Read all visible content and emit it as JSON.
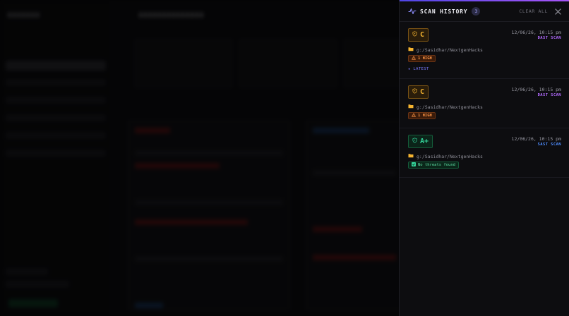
{
  "drawer": {
    "title": "SCAN HISTORY",
    "count": "3",
    "clear_label": "CLEAR ALL",
    "icon": "activity-icon",
    "close_icon": "close-icon",
    "accent_colors": [
      "#4f46e5",
      "#a855f7"
    ]
  },
  "entries": [
    {
      "grade": "C",
      "grade_icon": "shield-icon",
      "timestamp": "12/06/26, 10:15 pm",
      "scan_type": "DAST SCAN",
      "scan_type_color": "#b36bff",
      "path": "g:/Sasidhar/NextgenHacks",
      "badge": "1 HIGH",
      "badge_icon": "warning-icon",
      "latest_label": "★ LATEST"
    },
    {
      "grade": "C",
      "grade_icon": "shield-icon",
      "timestamp": "12/06/26, 10:15 pm",
      "scan_type": "DAST SCAN",
      "scan_type_color": "#b36bff",
      "path": "g:/Sasidhar/NextgenHacks",
      "badge": "1 HIGH",
      "badge_icon": "warning-icon"
    },
    {
      "grade": "A+",
      "grade_icon": "shield-icon",
      "timestamp": "12/06/26, 10:15 pm",
      "scan_type": "SAST SCAN",
      "scan_type_color": "#4f8dff",
      "path": "g:/Sasidhar/NextgenHacks",
      "badge": "No threats found",
      "badge_icon": "check-icon"
    }
  ]
}
